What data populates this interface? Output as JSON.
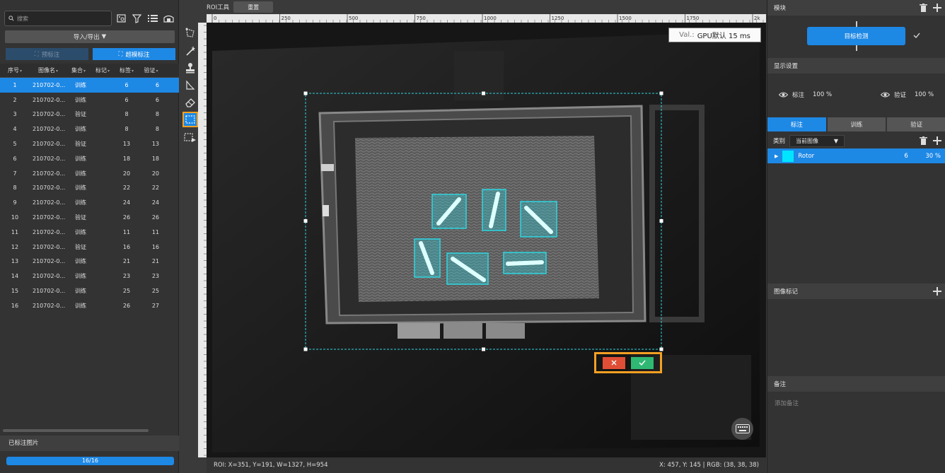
{
  "left_panel": {
    "search_placeholder": "搜索",
    "import_export_label": "导入/导出",
    "pre_label_button": "预标注",
    "super_label_button": "超模标注",
    "columns": [
      "序号",
      "图像名",
      "集合",
      "标记",
      "标签",
      "验证"
    ],
    "rows": [
      {
        "idx": "1",
        "name": "210702-0...",
        "set": "训练",
        "mark": "",
        "labels": "6",
        "verify": "6",
        "selected": true
      },
      {
        "idx": "2",
        "name": "210702-0...",
        "set": "训练",
        "mark": "",
        "labels": "6",
        "verify": "6"
      },
      {
        "idx": "3",
        "name": "210702-0...",
        "set": "验证",
        "mark": "",
        "labels": "8",
        "verify": "8"
      },
      {
        "idx": "4",
        "name": "210702-0...",
        "set": "训练",
        "mark": "",
        "labels": "8",
        "verify": "8"
      },
      {
        "idx": "5",
        "name": "210702-0...",
        "set": "验证",
        "mark": "",
        "labels": "13",
        "verify": "13"
      },
      {
        "idx": "6",
        "name": "210702-0...",
        "set": "训练",
        "mark": "",
        "labels": "18",
        "verify": "18"
      },
      {
        "idx": "7",
        "name": "210702-0...",
        "set": "训练",
        "mark": "",
        "labels": "20",
        "verify": "20"
      },
      {
        "idx": "8",
        "name": "210702-0...",
        "set": "训练",
        "mark": "",
        "labels": "22",
        "verify": "22"
      },
      {
        "idx": "9",
        "name": "210702-0...",
        "set": "训练",
        "mark": "",
        "labels": "24",
        "verify": "24"
      },
      {
        "idx": "10",
        "name": "210702-0...",
        "set": "验证",
        "mark": "",
        "labels": "26",
        "verify": "26"
      },
      {
        "idx": "11",
        "name": "210702-0...",
        "set": "训练",
        "mark": "",
        "labels": "11",
        "verify": "11"
      },
      {
        "idx": "12",
        "name": "210702-0...",
        "set": "验证",
        "mark": "",
        "labels": "16",
        "verify": "16"
      },
      {
        "idx": "13",
        "name": "210702-0...",
        "set": "训练",
        "mark": "",
        "labels": "21",
        "verify": "21"
      },
      {
        "idx": "14",
        "name": "210702-0...",
        "set": "训练",
        "mark": "",
        "labels": "23",
        "verify": "23"
      },
      {
        "idx": "15",
        "name": "210702-0...",
        "set": "训练",
        "mark": "",
        "labels": "25",
        "verify": "25"
      },
      {
        "idx": "16",
        "name": "210702-0...",
        "set": "训练",
        "mark": "",
        "labels": "26",
        "verify": "27"
      }
    ],
    "annotated_title": "已标注图片",
    "progress_text": "16/16",
    "progress_fraction": 1.0
  },
  "canvas": {
    "roi_tool_label": "ROI工具",
    "reset_label": "重置",
    "ruler_ticks": [
      "0",
      "250",
      "500",
      "750",
      "1000",
      "1250",
      "1500",
      "1750",
      "2k"
    ],
    "val_prefix": "Val.:",
    "val_text": "GPU默认 15 ms",
    "status_left": "ROI: X=351, Y=191, W=1327, H=954",
    "status_right": "X: 457, Y: 145 | RGB: (38, 38, 38)"
  },
  "right_panel": {
    "module_title": "模块",
    "module_button": "目标检测",
    "display_title": "显示设置",
    "label_opacity_name": "标注",
    "label_opacity_value": "100 %",
    "verify_opacity_name": "验证",
    "verify_opacity_value": "100 %",
    "tabs": [
      "标注",
      "训练",
      "验证"
    ],
    "category_label": "类别",
    "category_select": "当前图像",
    "class_name": "Rotor",
    "class_count": "6",
    "class_percent": "30 %",
    "class_color": "#00e5ff",
    "image_mark_title": "图像标记",
    "notes_title": "备注",
    "notes_placeholder": "添加备注"
  },
  "colors": {
    "accent": "#1e88e5",
    "highlight": "#f5a023",
    "cancel": "#e04e35",
    "confirm": "#2fb873",
    "annotation": "#2fd4e0"
  }
}
